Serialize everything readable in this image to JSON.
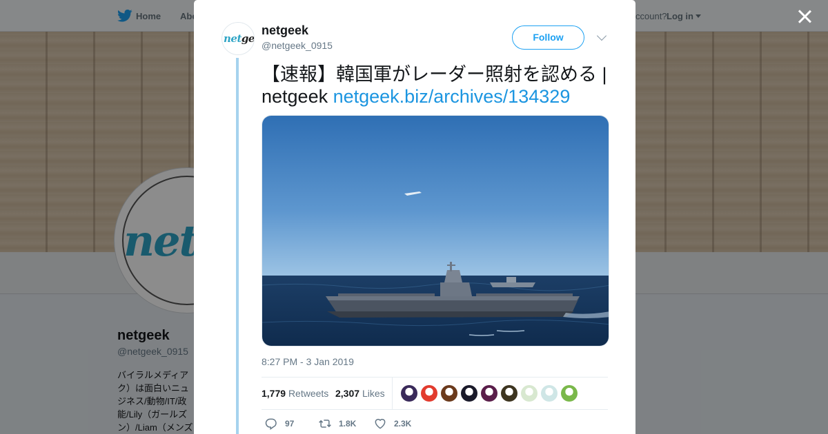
{
  "topnav": {
    "home_label": "Home",
    "about_label": "Abo",
    "login_prompt": "ccount?",
    "login_label": "Log in"
  },
  "profile": {
    "avatar_logo_a": "net",
    "avatar_logo_b": "ge",
    "name": "netgeek",
    "handle": "@netgeek_0915",
    "bio": "バイラルメディアク）は面白いニュジネス/動物/IT/政能/Lily（ガールズン）/Liam（メンズ"
  },
  "tweet": {
    "author_name": "netgeek",
    "author_handle": "@netgeek_0915",
    "avatar_logo_a": "net",
    "avatar_logo_b": "geek",
    "follow_label": "Follow",
    "text": "【速報】韓国軍がレーダー照射を認める | netgeek ",
    "link": "netgeek.biz/archives/134329",
    "timestamp": "8:27 PM - 3 Jan 2019",
    "retweets_count": "1,779",
    "retweets_label": "Retweets",
    "likes_count": "2,307",
    "likes_label": "Likes",
    "reply_count": "97",
    "retweet_action_count": "1.8K",
    "like_action_count": "2.3K",
    "liker_avatar_colors": [
      "#3a2a5a",
      "#e23b2e",
      "#6b3a1c",
      "#1a1a2a",
      "#5a1e4a",
      "#3d3520",
      "#d8e8d0",
      "#cfe6e6",
      "#7ab84a"
    ]
  },
  "colors": {
    "accent": "#1da1f2",
    "link": "#1b95e0",
    "thread_line": "#a6d3ee"
  }
}
